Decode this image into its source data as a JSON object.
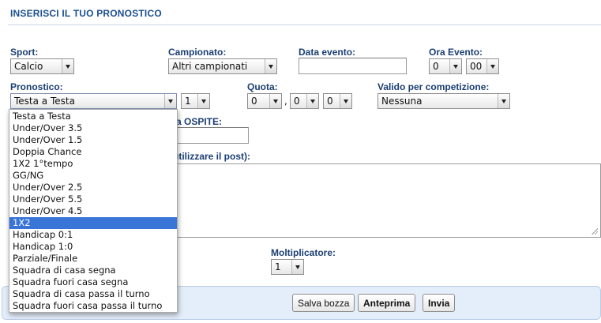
{
  "header": {
    "title": "INSERISCI IL TUO PRONOSTICO"
  },
  "row1": {
    "sport_label": "Sport:",
    "sport_value": "Calcio",
    "campionato_label": "Campionato:",
    "campionato_value": "Altri campionati",
    "data_label": "Data evento:",
    "data_value": "",
    "ora_label": "Ora Evento:",
    "ora_hour": "0",
    "ora_min": "00"
  },
  "row2": {
    "pronostico_label": "Pronostico:",
    "pronostico_value": "Testa a Testa",
    "pronostico_second": "1",
    "quota_label": "Quota:",
    "quota_int": "0",
    "quota_sep": ",",
    "quota_dec1": "0",
    "quota_dec2": "0",
    "valido_label": "Valido per competizione:",
    "valido_value": "Nessuna"
  },
  "row3": {
    "ospiti_label_partial": "a OSPITE:",
    "ospiti_value": ""
  },
  "row4": {
    "messaggio_label_partial": "utilizzare il post):"
  },
  "row5": {
    "moltiplicatore_label": "Moltiplicatore:",
    "moltiplicatore_value": "1"
  },
  "footer": {
    "salva_label": "Salva bozza",
    "anteprima_label": "Anteprima",
    "invia_label": "Invia"
  },
  "dropdown": {
    "highlight_color": "#3875d7",
    "options": [
      "Testa a Testa",
      "Under/Over 3.5",
      "Under/Over 1.5",
      "Doppia Chance",
      "1X2 1°tempo",
      "GG/NG",
      "Under/Over 2.5",
      "Under/Over 5.5",
      "Under/Over 4.5",
      "1X2",
      "Handicap 0:1",
      "Handicap 1:0",
      "Parziale/Finale",
      "Squadra di casa segna",
      "Squadra fuori casa segna",
      "Squadra di casa passa il turno",
      "Squadra fuori casa passa il turno"
    ],
    "highlighted": "1X2"
  }
}
